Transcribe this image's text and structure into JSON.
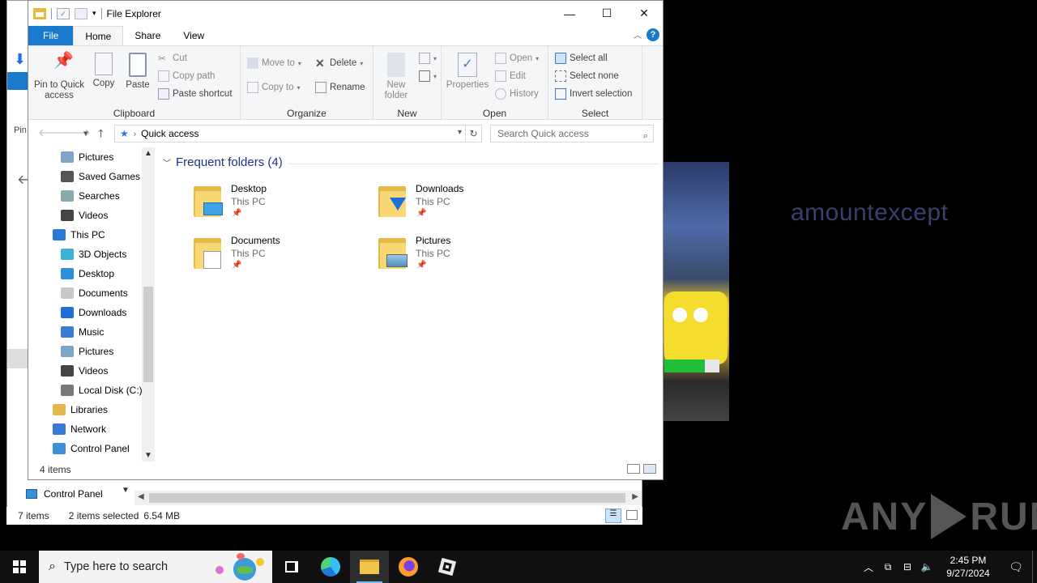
{
  "window": {
    "title": "File Explorer",
    "minimize": "—",
    "maximize": "☐",
    "close": "✕"
  },
  "tabs": [
    "File",
    "Home",
    "Share",
    "View"
  ],
  "help": "?",
  "ribbon": {
    "clipboard": {
      "name": "Clipboard",
      "pin": "Pin to Quick access",
      "copy": "Copy",
      "paste": "Paste",
      "cut": "Cut",
      "copy_path": "Copy path",
      "paste_shortcut": "Paste shortcut"
    },
    "organize": {
      "name": "Organize",
      "move_to": "Move to",
      "copy_to": "Copy to",
      "delete": "Delete",
      "rename": "Rename"
    },
    "new": {
      "name": "New",
      "new_folder": "New folder"
    },
    "open": {
      "name": "Open",
      "properties": "Properties",
      "open": "Open",
      "edit": "Edit",
      "history": "History"
    },
    "select": {
      "name": "Select",
      "select_all": "Select all",
      "select_none": "Select none",
      "invert": "Invert selection"
    }
  },
  "address": {
    "path": "Quick access",
    "search_placeholder": "Search Quick access"
  },
  "nav": [
    {
      "label": "Pictures",
      "indent": 2,
      "icon": "pictures-icon"
    },
    {
      "label": "Saved Games",
      "indent": 2,
      "icon": "saved-games-icon"
    },
    {
      "label": "Searches",
      "indent": 2,
      "icon": "searches-icon"
    },
    {
      "label": "Videos",
      "indent": 2,
      "icon": "videos-icon"
    },
    {
      "label": "This PC",
      "indent": 1,
      "icon": "this-pc-icon"
    },
    {
      "label": "3D Objects",
      "indent": 2,
      "icon": "3d-objects-icon"
    },
    {
      "label": "Desktop",
      "indent": 2,
      "icon": "desktop-icon"
    },
    {
      "label": "Documents",
      "indent": 2,
      "icon": "documents-icon"
    },
    {
      "label": "Downloads",
      "indent": 2,
      "icon": "downloads-icon"
    },
    {
      "label": "Music",
      "indent": 2,
      "icon": "music-icon"
    },
    {
      "label": "Pictures",
      "indent": 2,
      "icon": "pictures-icon"
    },
    {
      "label": "Videos",
      "indent": 2,
      "icon": "videos-icon"
    },
    {
      "label": "Local Disk (C:)",
      "indent": 2,
      "icon": "disk-icon"
    },
    {
      "label": "Libraries",
      "indent": 1,
      "icon": "libraries-icon"
    },
    {
      "label": "Network",
      "indent": 1,
      "icon": "network-icon"
    },
    {
      "label": "Control Panel",
      "indent": 1,
      "icon": "control-panel-icon"
    }
  ],
  "content": {
    "group_title": "Frequent folders (4)",
    "folders": [
      {
        "name": "Desktop",
        "location": "This PC",
        "overlay": "desktop"
      },
      {
        "name": "Downloads",
        "location": "This PC",
        "overlay": "downloads"
      },
      {
        "name": "Documents",
        "location": "This PC",
        "overlay": "documents"
      },
      {
        "name": "Pictures",
        "location": "This PC",
        "overlay": "pictures"
      }
    ]
  },
  "status": {
    "items": "4 items"
  },
  "background_window": {
    "nav_item": "Control Panel",
    "pin_label": "Pin",
    "status_items": "7 items",
    "status_selected": "2 items selected",
    "status_size": "6.54 MB"
  },
  "overlay_text": "amountexcept",
  "watermark": "ANY RUN",
  "taskbar": {
    "search_placeholder": "Type here to search",
    "time": "2:45 PM",
    "date": "9/27/2024"
  }
}
